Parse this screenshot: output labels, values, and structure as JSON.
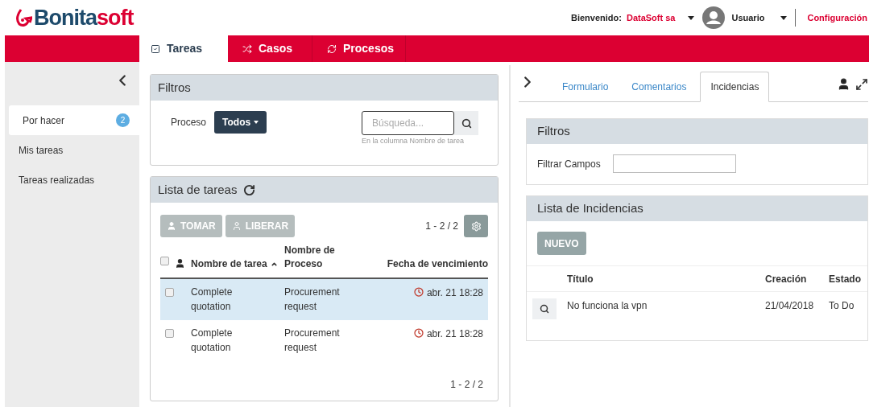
{
  "logo": {
    "dark": "Bonita",
    "accent": "soft"
  },
  "header": {
    "welcome_label": "Bienvenido:",
    "organization": "DataSoft sa",
    "user": "Usuario",
    "settings_link": "Configuración"
  },
  "nav_tabs": [
    {
      "label": "Tareas",
      "selected": true
    },
    {
      "label": "Casos",
      "selected": false
    },
    {
      "label": "Procesos",
      "selected": false
    }
  ],
  "sidebar": {
    "items": [
      {
        "label": "Por hacer",
        "count": "2",
        "selected": true
      },
      {
        "label": "Mis tareas",
        "selected": false
      },
      {
        "label": "Tareas realizadas",
        "selected": false
      }
    ]
  },
  "filters": {
    "title": "Filtros",
    "process_label": "Proceso",
    "process_value": "Todos",
    "search_placeholder": "Búsqueda...",
    "search_hint": "En la columna Nombre de tarea"
  },
  "task_list": {
    "title": "Lista de tareas",
    "take_button": {
      "label": "TOMAR",
      "disabled": true
    },
    "release_button": {
      "label": "LIBERAR",
      "disabled": true
    },
    "pager_top": "1 - 2 / 2",
    "pager_bottom": "1 - 2 / 2",
    "columns": [
      "Nombre de tarea",
      "Nombre de Proceso",
      "Fecha de vencimiento"
    ],
    "select_all_checked": false,
    "rows": [
      {
        "task": "Complete quotation",
        "process": "Procurement request",
        "due": "abr. 21 18:28",
        "checked": false,
        "selected": true
      },
      {
        "task": "Complete quotation",
        "process": "Procurement request",
        "due": "abr. 21 18:28",
        "checked": false,
        "selected": false
      }
    ]
  },
  "detail_tabs": [
    {
      "label": "Formulario",
      "selected": false
    },
    {
      "label": "Comentarios",
      "selected": false
    },
    {
      "label": "Incidencias",
      "selected": true
    }
  ],
  "detail_filters": {
    "title": "Filtros",
    "field_label": "Filtrar Campos"
  },
  "incidents": {
    "title": "Lista de Incidencias",
    "new_button": "NUEVO",
    "columns": [
      "Título",
      "Creación",
      "Estado"
    ],
    "rows": [
      {
        "title": "No funciona la vpn",
        "created": "21/04/2018",
        "status": "To Do"
      }
    ]
  }
}
